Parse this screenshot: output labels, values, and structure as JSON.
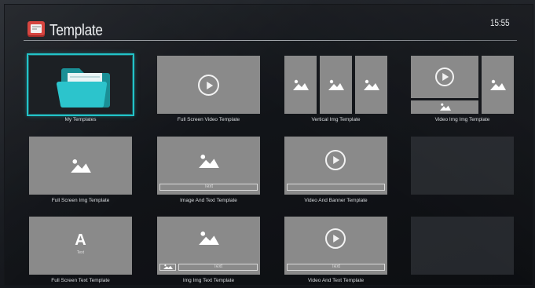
{
  "header": {
    "title": "Template",
    "clock": "15:55"
  },
  "tiles": [
    {
      "caption": "My Templates"
    },
    {
      "caption": "Full Screen Video Template"
    },
    {
      "caption": "Vertical Img Template"
    },
    {
      "caption": "Video Img Img Template"
    },
    {
      "caption": "Full Screen Img Template"
    },
    {
      "caption": "Image And Text Template",
      "text_label": "Text"
    },
    {
      "caption": "Video And Banner Template"
    },
    {
      "caption": ""
    },
    {
      "caption": "Full Screen Text Template",
      "letter": "A",
      "sub": "Text"
    },
    {
      "caption": "Img Img Text Template",
      "text_label": "Text"
    },
    {
      "caption": "Video And Text Template",
      "text_label": "Text"
    },
    {
      "caption": ""
    }
  ],
  "colors": {
    "accent": "#22c3c8",
    "tile": "#8a8a8a",
    "title_icon": "#d64540"
  }
}
